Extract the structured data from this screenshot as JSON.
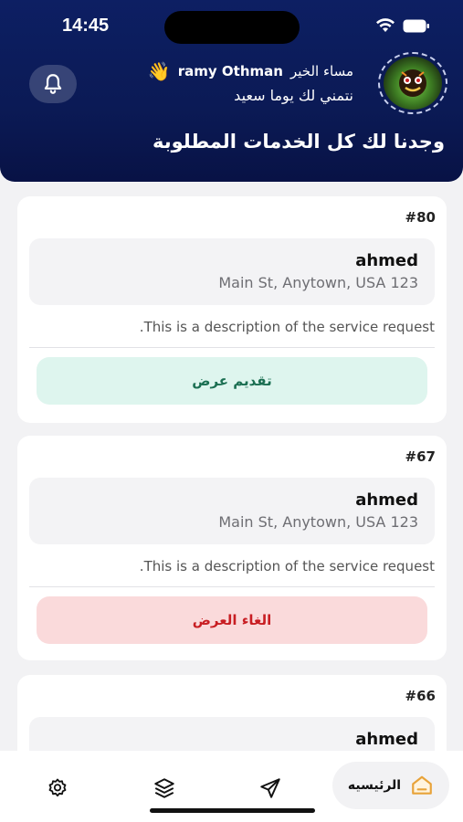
{
  "status_bar": {
    "time": "14:45"
  },
  "header": {
    "greeting": "مساء الخير",
    "username": "ramy Othman",
    "wave_emoji": "👋",
    "wish": "نتمني لك يوما سعيد",
    "headline": "وجدنا لك كل الخدمات المطلوبة",
    "icons": [
      "bell-icon",
      "avatar"
    ]
  },
  "requests": [
    {
      "id": "#80",
      "client_name": "ahmed",
      "address": "Main St, Anytown, USA 123",
      "description": ".This is a description of the service request",
      "action_label": "تقديم عرض",
      "action_type": "offer"
    },
    {
      "id": "#67",
      "client_name": "ahmed",
      "address": "Main St, Anytown, USA 123",
      "description": ".This is a description of the service request",
      "action_label": "الغاء العرض",
      "action_type": "cancel"
    },
    {
      "id": "#66",
      "client_name": "ahmed"
    }
  ],
  "bottom_nav": {
    "home_label": "الرئيسيه",
    "items": [
      "home-icon",
      "send-icon",
      "layers-icon",
      "settings-icon"
    ]
  },
  "colors": {
    "header_bg": "#0b1a55",
    "offer_bg": "#def5ee",
    "offer_text": "#1b6f52",
    "cancel_bg": "#fadadb",
    "cancel_text": "#c81e23",
    "home_icon": "#e8a33a"
  }
}
